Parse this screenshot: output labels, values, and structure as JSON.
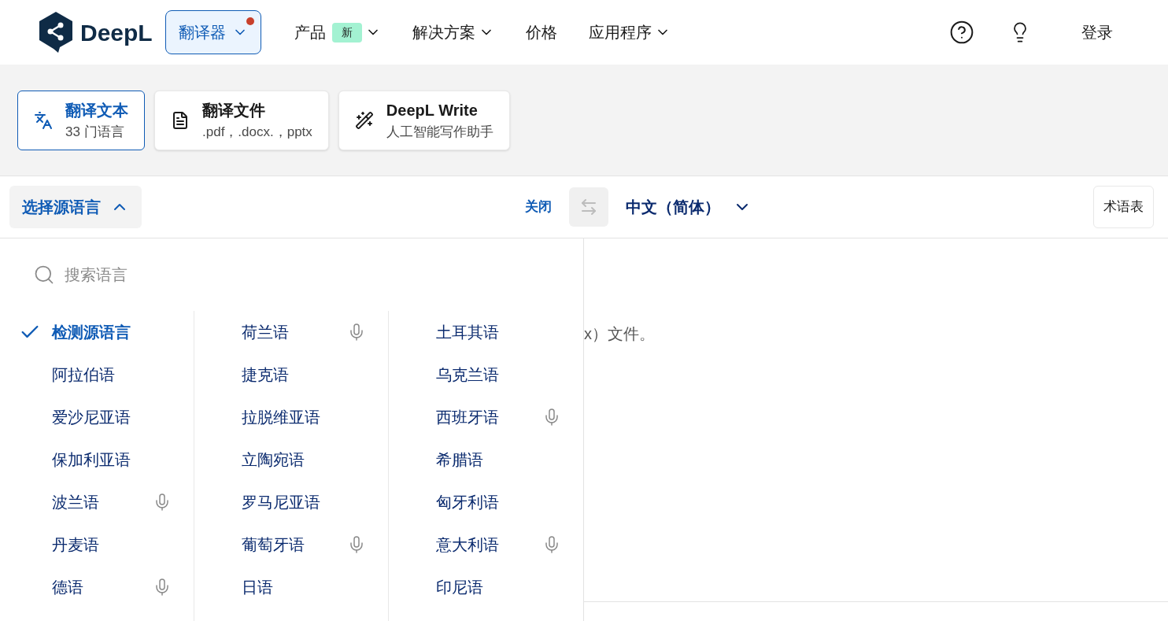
{
  "header": {
    "logo": "DeepL",
    "translator_menu": {
      "label": "翻译器",
      "notification": true
    },
    "nav": [
      {
        "label": "产品",
        "badge": "新",
        "dropdown": true
      },
      {
        "label": "解决方案",
        "dropdown": true
      },
      {
        "label": "价格",
        "dropdown": false
      },
      {
        "label": "应用程序",
        "dropdown": true
      }
    ],
    "login": "登录"
  },
  "tools": [
    {
      "kind": "text",
      "title": "翻译文本",
      "subtitle": "33 门语言",
      "selected": true
    },
    {
      "kind": "document",
      "title": "翻译文件",
      "subtitle": ".pdf，.docx.，pptx",
      "selected": false
    },
    {
      "kind": "write",
      "title": "DeepL Write",
      "subtitle": "人工智能写作助手",
      "selected": false
    }
  ],
  "language_bar": {
    "source": {
      "label": "选择源语言",
      "expanded": true
    },
    "close": "关闭",
    "target": "中文（简体）",
    "glossary": "术语表"
  },
  "dropdown": {
    "search_placeholder": "搜索语言",
    "columns": [
      [
        {
          "name": "检测源语言",
          "selected": true,
          "voice": false
        },
        {
          "name": "阿拉伯语",
          "selected": false,
          "voice": false
        },
        {
          "name": "爱沙尼亚语",
          "selected": false,
          "voice": false
        },
        {
          "name": "保加利亚语",
          "selected": false,
          "voice": false
        },
        {
          "name": "波兰语",
          "selected": false,
          "voice": true
        },
        {
          "name": "丹麦语",
          "selected": false,
          "voice": false
        },
        {
          "name": "德语",
          "selected": false,
          "voice": true
        }
      ],
      [
        {
          "name": "荷兰语",
          "selected": false,
          "voice": true
        },
        {
          "name": "捷克语",
          "selected": false,
          "voice": false
        },
        {
          "name": "拉脱维亚语",
          "selected": false,
          "voice": false
        },
        {
          "name": "立陶宛语",
          "selected": false,
          "voice": false
        },
        {
          "name": "罗马尼亚语",
          "selected": false,
          "voice": false
        },
        {
          "name": "葡萄牙语",
          "selected": false,
          "voice": true
        },
        {
          "name": "日语",
          "selected": false,
          "voice": false
        }
      ],
      [
        {
          "name": "土耳其语",
          "selected": false,
          "voice": false
        },
        {
          "name": "乌克兰语",
          "selected": false,
          "voice": false
        },
        {
          "name": "西班牙语",
          "selected": false,
          "voice": true
        },
        {
          "name": "希腊语",
          "selected": false,
          "voice": false
        },
        {
          "name": "匈牙利语",
          "selected": false,
          "voice": false
        },
        {
          "name": "意大利语",
          "selected": false,
          "voice": true
        },
        {
          "name": "印尼语",
          "selected": false,
          "voice": false
        }
      ]
    ]
  },
  "target_text": "x）文件。"
}
